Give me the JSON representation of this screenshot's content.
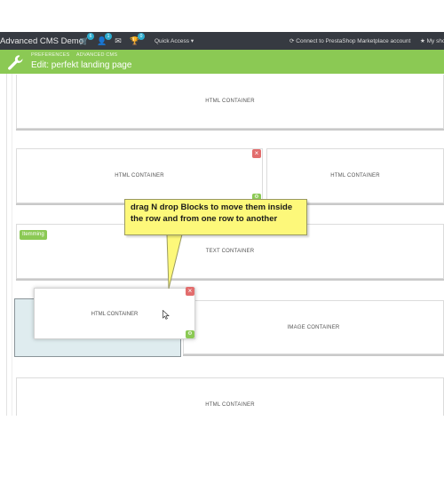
{
  "header": {
    "brand": "Advanced CMS Demo",
    "icons": [
      {
        "name": "cart-icon",
        "glyph": "🛒",
        "badge": "6"
      },
      {
        "name": "user-icon",
        "glyph": "👤",
        "badge": "1"
      },
      {
        "name": "mail-icon",
        "glyph": "✉",
        "badge": ""
      },
      {
        "name": "trophy-icon",
        "glyph": "🏆",
        "badge": "0"
      }
    ],
    "quick_access": "Quick Access ▾",
    "connect": "Connect to PrestaShop Marketplace account",
    "my_shop": "★ My shop"
  },
  "page_header": {
    "breadcrumb": [
      "PREFERENCES",
      "ADVANCED CMS"
    ],
    "title": "Edit: perfekt landing page",
    "accent": "#8bc954"
  },
  "editor": {
    "rows": [
      {
        "label": "HTML CONTAINER"
      },
      {
        "left": "HTML CONTAINER",
        "right": "HTML CONTAINER"
      },
      {
        "tag": "Itemming",
        "label": "TEXT CONTAINER"
      },
      {
        "dragging": "HTML CONTAINER",
        "right": "IMAGE CONTAINER"
      },
      {
        "label": "HTML CONTAINER"
      }
    ],
    "delete_glyph": "×",
    "settings_glyph": "⚙"
  },
  "callout": {
    "text": "drag N drop Blocks to move them inside the row and from one row to another",
    "color": "#fdf87a"
  }
}
